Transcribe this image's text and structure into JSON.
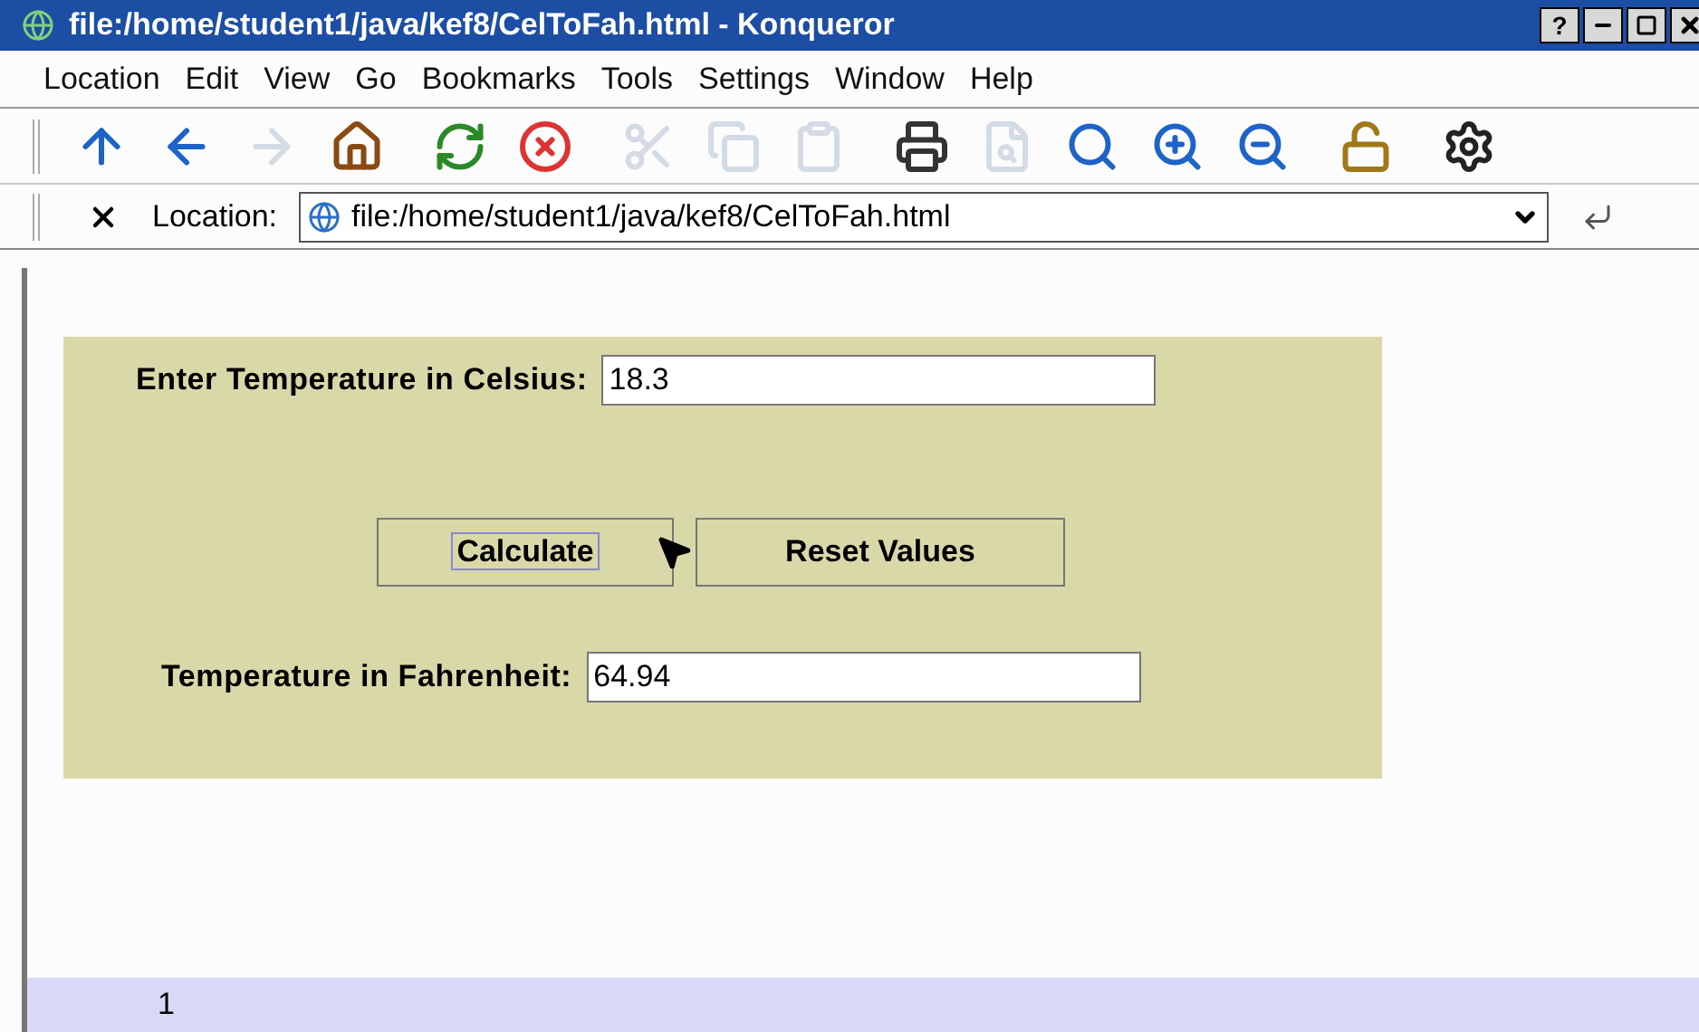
{
  "window": {
    "title": "file:/home/student1/java/kef8/CelToFah.html - Konqueror",
    "help_button": "?"
  },
  "menu": [
    "Location",
    "Edit",
    "View",
    "Go",
    "Bookmarks",
    "Tools",
    "Settings",
    "Window",
    "Help"
  ],
  "toolbar": [
    {
      "kind": "up",
      "disabled": false
    },
    {
      "kind": "back",
      "disabled": false
    },
    {
      "kind": "forward",
      "disabled": true
    },
    {
      "kind": "home",
      "disabled": false
    },
    {
      "kind": "reload",
      "disabled": false
    },
    {
      "kind": "stop",
      "disabled": false
    },
    {
      "kind": "cut",
      "disabled": true
    },
    {
      "kind": "copy",
      "disabled": true
    },
    {
      "kind": "paste",
      "disabled": true
    },
    {
      "kind": "print",
      "disabled": false
    },
    {
      "kind": "print-preview",
      "disabled": true
    },
    {
      "kind": "find",
      "disabled": false
    },
    {
      "kind": "zoom-in",
      "disabled": false
    },
    {
      "kind": "zoom-out",
      "disabled": false
    },
    {
      "kind": "security",
      "disabled": false
    },
    {
      "kind": "settings",
      "disabled": false
    }
  ],
  "location_bar": {
    "label": "Location:",
    "url": "file:/home/student1/java/kef8/CelToFah.html"
  },
  "form": {
    "celsius_label": "Enter Temperature in Celsius:",
    "celsius_value": "18.3",
    "buttons": [
      {
        "label": "Calculate",
        "focused": true
      },
      {
        "label": "Reset Values",
        "focused": false
      }
    ],
    "fahrenheit_label": "Temperature in Fahrenheit:",
    "fahrenheit_value": "64.94"
  },
  "status_bar": {
    "text": "1"
  }
}
